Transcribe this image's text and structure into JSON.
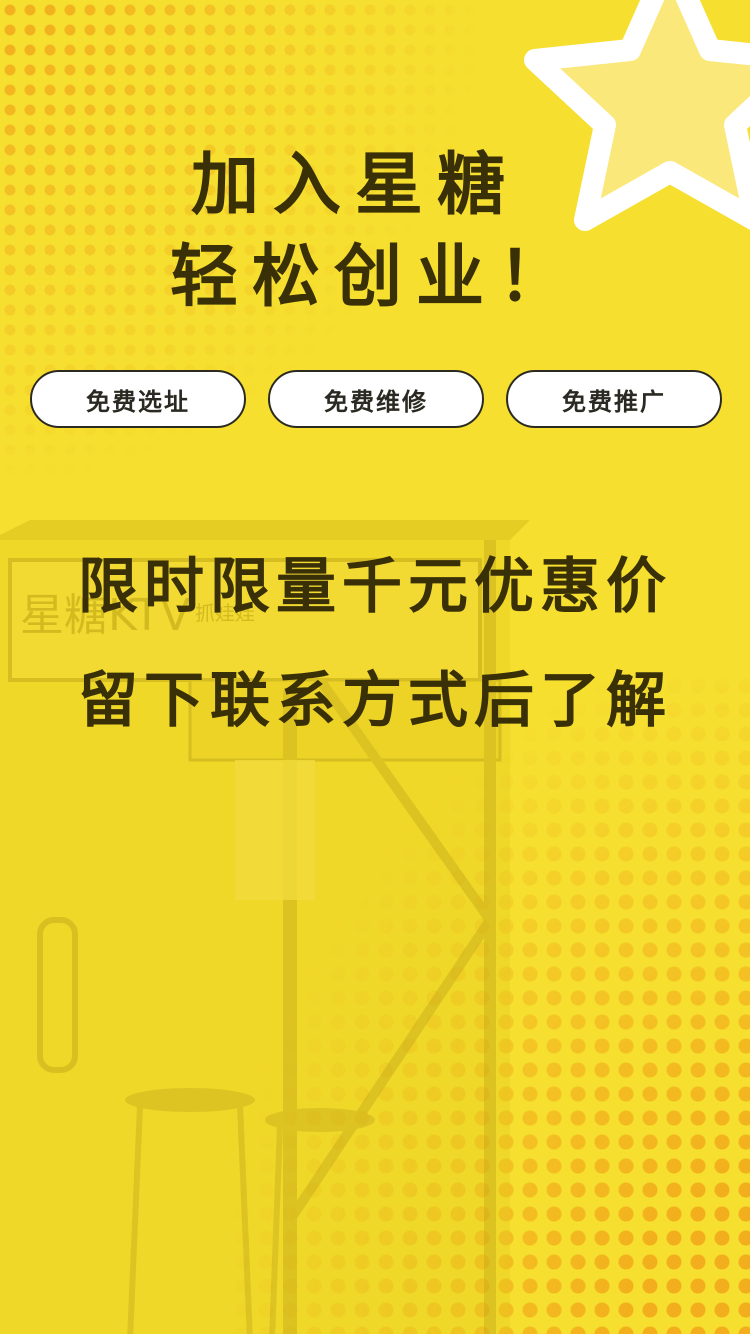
{
  "headline": {
    "line1": "加入星糖",
    "line2": "轻松创业！"
  },
  "pills": [
    {
      "label": "免费选址"
    },
    {
      "label": "免费维修"
    },
    {
      "label": "免费推广"
    }
  ],
  "promo": {
    "line1": "限时限量千元优惠价",
    "line2": "留下联系方式后了解"
  },
  "booth_sign": {
    "brand": "星糖KTV",
    "subtitle": "抓娃娃"
  },
  "colors": {
    "background": "#f6df2f",
    "text": "#3a3008",
    "pill_bg": "#ffffff",
    "dots": "#f2b21f"
  },
  "icons": [
    "star-decoration-icon"
  ]
}
